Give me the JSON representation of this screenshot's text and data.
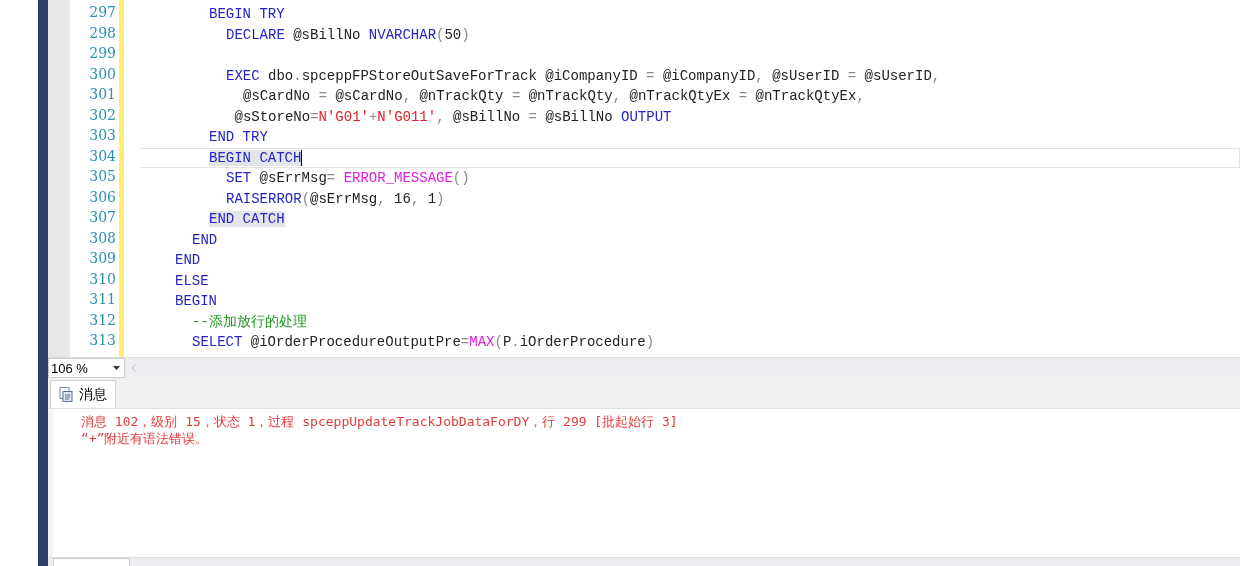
{
  "editor": {
    "lines": [
      {
        "number": "297",
        "current": false,
        "matched": false,
        "tokens": [
          {
            "kind": "kw",
            "text": "        BEGIN TRY"
          }
        ]
      },
      {
        "number": "298",
        "current": false,
        "matched": false,
        "tokens": [
          {
            "kind": "kw",
            "text": "          DECLARE "
          },
          {
            "kind": "id",
            "text": "@sBillNo "
          },
          {
            "kind": "kw",
            "text": "NVARCHAR"
          },
          {
            "kind": "op",
            "text": "("
          },
          {
            "kind": "id",
            "text": "50"
          },
          {
            "kind": "op",
            "text": ")"
          }
        ]
      },
      {
        "number": "299",
        "current": false
      },
      {
        "number": "300",
        "current": false,
        "matched": false,
        "tokens": [
          {
            "kind": "kw",
            "text": "          EXEC "
          },
          {
            "kind": "id",
            "text": "dbo"
          },
          {
            "kind": "op",
            "text": "."
          },
          {
            "kind": "id",
            "text": "spceppFPStoreOutSaveForTrack @iCompanyID "
          },
          {
            "kind": "op",
            "text": "="
          },
          {
            "kind": "id",
            "text": " @iCompanyID"
          },
          {
            "kind": "op",
            "text": ", "
          },
          {
            "kind": "id",
            "text": "@sUserID "
          },
          {
            "kind": "op",
            "text": "="
          },
          {
            "kind": "id",
            "text": " @sUserID"
          },
          {
            "kind": "op",
            "text": ","
          }
        ]
      },
      {
        "number": "301",
        "current": false,
        "matched": false,
        "tokens": [
          {
            "kind": "id",
            "text": "            @sCardNo "
          },
          {
            "kind": "op",
            "text": "="
          },
          {
            "kind": "id",
            "text": " @sCardNo"
          },
          {
            "kind": "op",
            "text": ", "
          },
          {
            "kind": "id",
            "text": "@nTrackQty "
          },
          {
            "kind": "op",
            "text": "="
          },
          {
            "kind": "id",
            "text": " @nTrackQty"
          },
          {
            "kind": "op",
            "text": ", "
          },
          {
            "kind": "id",
            "text": "@nTrackQtyEx "
          },
          {
            "kind": "op",
            "text": "="
          },
          {
            "kind": "id",
            "text": " @nTrackQtyEx"
          },
          {
            "kind": "op",
            "text": ","
          }
        ]
      },
      {
        "number": "302",
        "current": false,
        "matched": false,
        "tokens": [
          {
            "kind": "id",
            "text": "           @sStoreNo"
          },
          {
            "kind": "op",
            "text": "="
          },
          {
            "kind": "str",
            "text": "N'G01'"
          },
          {
            "kind": "op",
            "text": "+"
          },
          {
            "kind": "str",
            "text": "N'G011'"
          },
          {
            "kind": "op",
            "text": ", "
          },
          {
            "kind": "id",
            "text": "@sBillNo "
          },
          {
            "kind": "op",
            "text": "="
          },
          {
            "kind": "id",
            "text": " @sBillNo "
          },
          {
            "kind": "kw",
            "text": "OUTPUT"
          }
        ]
      },
      {
        "number": "303",
        "current": false,
        "matched": false,
        "tokens": [
          {
            "kind": "kw",
            "text": "        END TRY"
          }
        ]
      },
      {
        "number": "304",
        "current": true,
        "matched": true,
        "tokens": [
          {
            "kind": "kw",
            "text": "        BEGIN CATCH"
          }
        ]
      },
      {
        "number": "305",
        "current": false,
        "matched": false,
        "tokens": [
          {
            "kind": "kw",
            "text": "          SET "
          },
          {
            "kind": "id",
            "text": "@sErrMsg"
          },
          {
            "kind": "op",
            "text": "= "
          },
          {
            "kind": "fn",
            "text": "ERROR_MESSAGE"
          },
          {
            "kind": "op",
            "text": "()"
          }
        ]
      },
      {
        "number": "306",
        "current": false,
        "matched": false,
        "tokens": [
          {
            "kind": "kw",
            "text": "          RAISERROR"
          },
          {
            "kind": "op",
            "text": "("
          },
          {
            "kind": "id",
            "text": "@sErrMsg"
          },
          {
            "kind": "op",
            "text": ", "
          },
          {
            "kind": "id",
            "text": "16"
          },
          {
            "kind": "op",
            "text": ", "
          },
          {
            "kind": "id",
            "text": "1"
          },
          {
            "kind": "op",
            "text": ")"
          }
        ]
      },
      {
        "number": "307",
        "current": false,
        "matched": true,
        "tokens": [
          {
            "kind": "kw",
            "text": "        END CATCH"
          }
        ]
      },
      {
        "number": "308",
        "current": false,
        "matched": false,
        "tokens": [
          {
            "kind": "kw",
            "text": "      END"
          }
        ]
      },
      {
        "number": "309",
        "current": false,
        "matched": false,
        "tokens": [
          {
            "kind": "kw",
            "text": "    END"
          }
        ]
      },
      {
        "number": "310",
        "current": false,
        "matched": false,
        "tokens": [
          {
            "kind": "kw",
            "text": "    ELSE"
          }
        ]
      },
      {
        "number": "311",
        "current": false,
        "matched": false,
        "tokens": [
          {
            "kind": "kw",
            "text": "    BEGIN"
          }
        ]
      },
      {
        "number": "312",
        "current": false,
        "matched": false,
        "tokens": [
          {
            "kind": "cm",
            "text": "      --添加放行的处理"
          }
        ]
      },
      {
        "number": "313",
        "current": false,
        "matched": false,
        "tokens": [
          {
            "kind": "kw",
            "text": "      SELECT "
          },
          {
            "kind": "id",
            "text": "@iOrderProcedureOutputPre"
          },
          {
            "kind": "op",
            "text": "="
          },
          {
            "kind": "fn",
            "text": "MAX"
          },
          {
            "kind": "op",
            "text": "("
          },
          {
            "kind": "id",
            "text": "P"
          },
          {
            "kind": "op",
            "text": "."
          },
          {
            "kind": "id",
            "text": "iOrderProcedure"
          },
          {
            "kind": "op",
            "text": ")"
          }
        ]
      }
    ]
  },
  "zoom": "106 %",
  "results": {
    "tabs": [
      {
        "label": "消息",
        "selected": true
      }
    ],
    "messages": [
      "消息 102，级别 15，状态 1，过程 spceppUpdateTrackJobDataForDY，行 299 [批起始行 3]",
      "“+”附近有语法错误。"
    ]
  }
}
